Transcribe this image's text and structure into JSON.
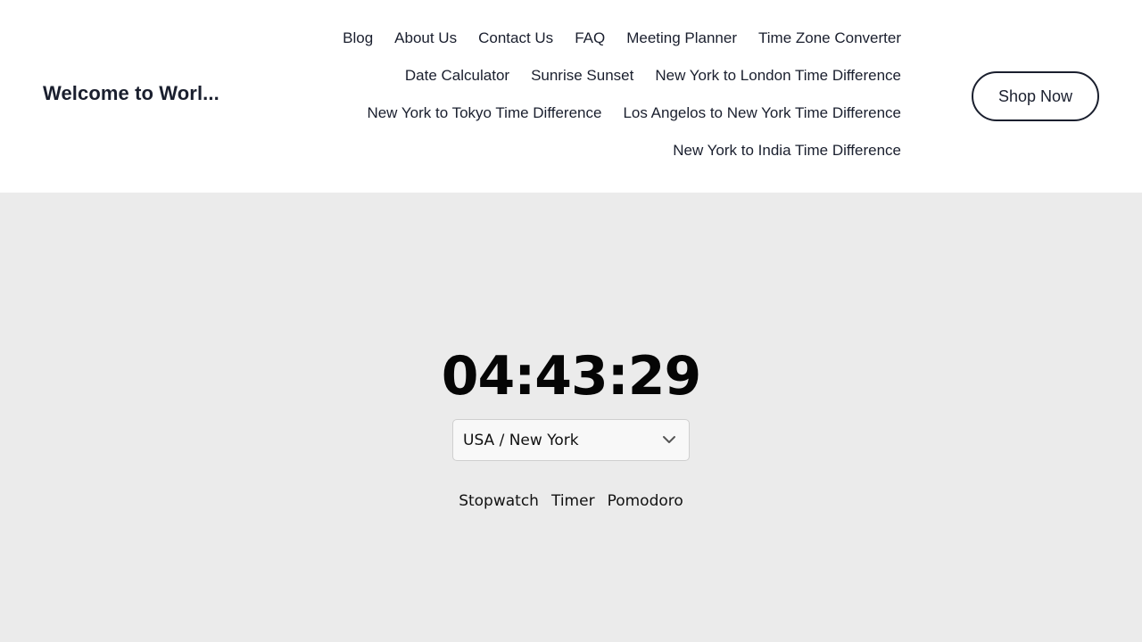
{
  "header": {
    "site_title": "Welcome to Worl...",
    "nav": {
      "rows": [
        [
          "Blog",
          "About Us",
          "Contact Us",
          "FAQ",
          "Meeting Planner",
          "Time Zone Converter"
        ],
        [
          "Date Calculator",
          "Sunrise Sunset",
          "New York to London Time Difference"
        ],
        [
          "New York to Tokyo Time Difference",
          "Los Angelos to New York Time Difference"
        ],
        [
          "New York to India Time Difference"
        ]
      ]
    },
    "shop_button": "Shop Now"
  },
  "main": {
    "clock_time": "04:43:29",
    "timezone_select": {
      "selected": "USA / New York",
      "icon": "chevron-down-icon"
    },
    "tools": [
      "Stopwatch",
      "Timer",
      "Pomodoro"
    ]
  },
  "colors": {
    "header_bg": "#ffffff",
    "page_bg": "#ebebeb",
    "text": "#1a1f2e"
  }
}
